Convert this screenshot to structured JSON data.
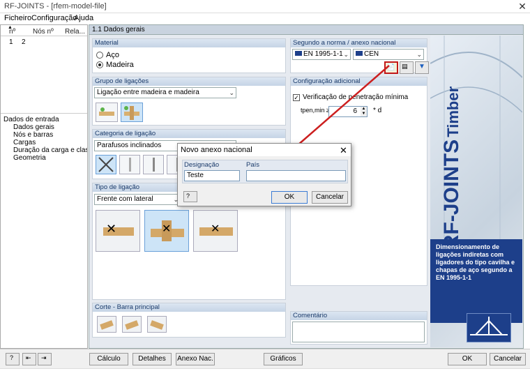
{
  "window": {
    "title": "RF-JOINTS - [rfem-model-file]"
  },
  "menu": [
    "Ficheiro",
    "Configuração",
    "Ajuda"
  ],
  "left_table": {
    "headers": [
      "nº",
      "Nós nº",
      "Rela..."
    ],
    "row": [
      "1",
      "2"
    ]
  },
  "nav_tree": {
    "root": "Dados de entrada",
    "items": [
      "Dados gerais",
      "Nós e barras",
      "Cargas",
      "Duração da carga e classe de u",
      "Geometria"
    ]
  },
  "main_header": "1.1 Dados gerais",
  "material": {
    "label": "Material",
    "options": [
      "Aço",
      "Madeira"
    ],
    "selected": "Madeira"
  },
  "norma": {
    "label": "Segundo a norma / anexo nacional",
    "standard": "EN 1995-1-1",
    "annex": "CEN"
  },
  "grupo": {
    "label": "Grupo de ligações",
    "value": "Ligação entre madeira e madeira"
  },
  "config": {
    "label": "Configuração adicional",
    "check_label": "Verificação de penetração mínima",
    "param_label": "tpen,min ≥",
    "param_value": "6",
    "param_unit": "* d"
  },
  "categoria": {
    "label": "Categoria de ligação",
    "value": "Parafusos inclinados"
  },
  "tipo": {
    "label": "Tipo de ligação",
    "value": "Frente com lateral"
  },
  "corte": {
    "label": "Corte - Barra principal"
  },
  "comentario": {
    "label": "Comentário"
  },
  "banner": {
    "title": "RF-JOINTS",
    "subtitle": "Timber",
    "description": "Dimensionamento de ligações indiretas com ligadores do tipo cavilha e chapas de aço segundo a EN 1995-1-1"
  },
  "footer": {
    "calc": "Cálculo",
    "details": "Detalhes",
    "annex": "Anexo Nac.",
    "graphics": "Gráficos",
    "ok": "OK",
    "cancel": "Cancelar"
  },
  "dialog": {
    "title": "Novo anexo nacional",
    "designation_label": "Designação",
    "country_label": "País",
    "designation_value": "Teste",
    "country_value": "",
    "ok": "OK",
    "cancel": "Cancelar"
  },
  "colors": {
    "accent": "#1d3f8a",
    "arrow": "#cc1f1f",
    "selection": "#cde4f7"
  }
}
